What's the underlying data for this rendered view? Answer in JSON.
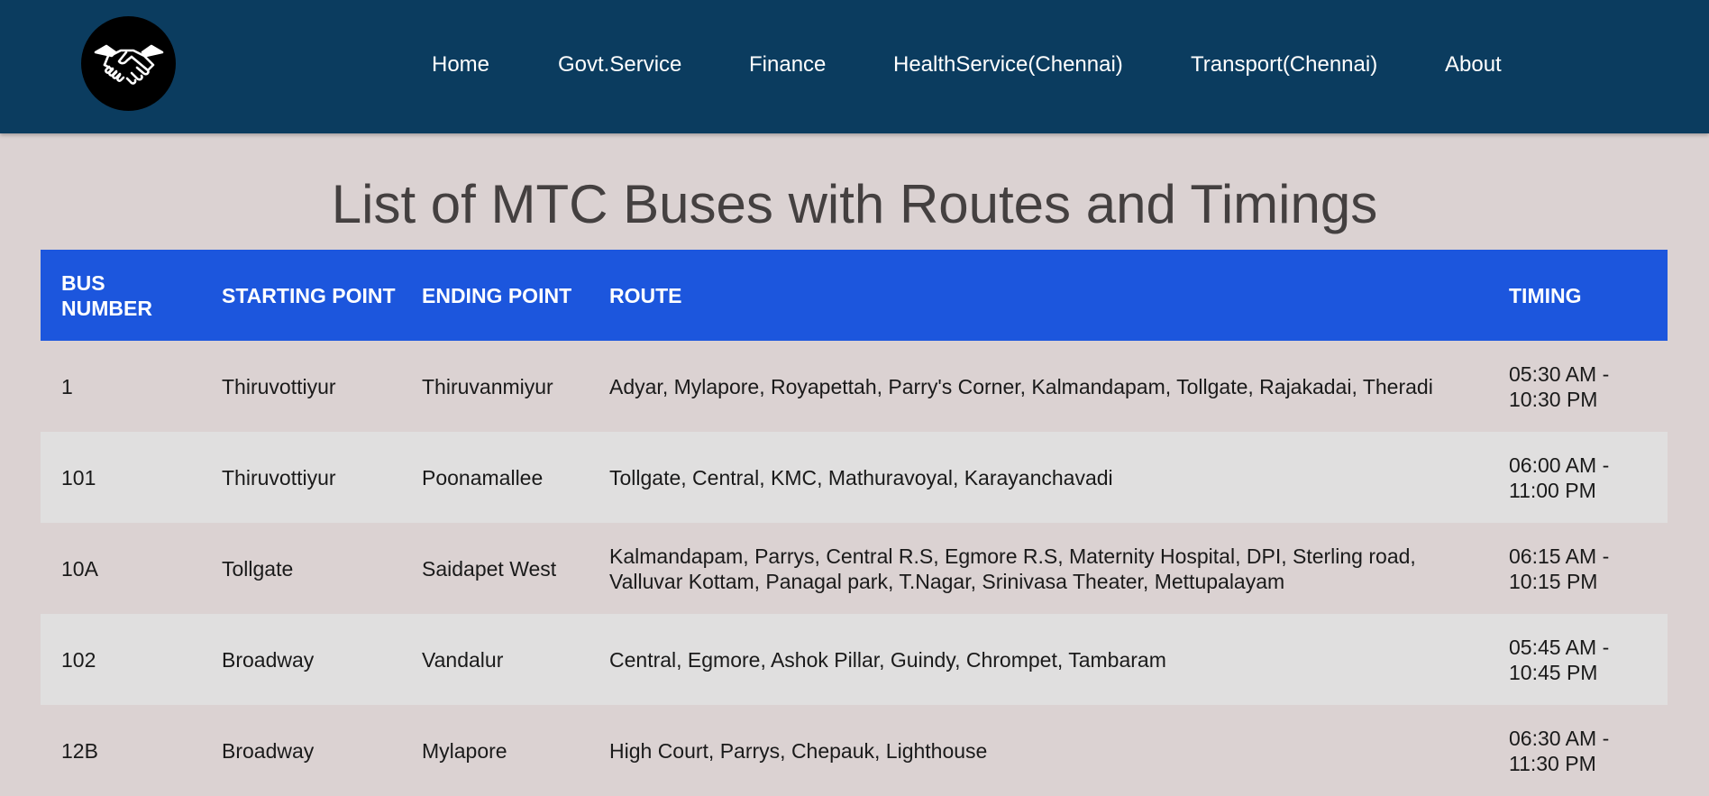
{
  "header": {
    "logo_icon": "handshake-icon",
    "nav": [
      {
        "label": "Home"
      },
      {
        "label": "Govt.Service"
      },
      {
        "label": "Finance"
      },
      {
        "label": "HealthService(Chennai)"
      },
      {
        "label": "Transport(Chennai)"
      },
      {
        "label": "About"
      }
    ]
  },
  "main": {
    "title": "List of MTC Buses with Routes and Timings",
    "table": {
      "columns": [
        "BUS NUMBER",
        "STARTING POINT",
        "ENDING POINT",
        "ROUTE",
        "TIMING"
      ],
      "rows": [
        {
          "bus": "1",
          "start": "Thiruvottiyur",
          "end": "Thiruvanmiyur",
          "route": "Adyar, Mylapore, Royapettah, Parry's Corner, Kalmandapam, Tollgate, Rajakadai, Theradi",
          "timing": "05:30 AM - 10:30 PM"
        },
        {
          "bus": "101",
          "start": "Thiruvottiyur",
          "end": "Poonamallee",
          "route": "Tollgate, Central, KMC, Mathuravoyal, Karayanchavadi",
          "timing": "06:00 AM - 11:00 PM"
        },
        {
          "bus": "10A",
          "start": "Tollgate",
          "end": "Saidapet West",
          "route": "Kalmandapam, Parrys, Central R.S, Egmore R.S, Maternity Hospital, DPI, Sterling road, Valluvar Kottam, Panagal park, T.Nagar, Srinivasa Theater, Mettupalayam",
          "timing": "06:15 AM - 10:15 PM"
        },
        {
          "bus": "102",
          "start": "Broadway",
          "end": "Vandalur",
          "route": "Central, Egmore, Ashok Pillar, Guindy, Chrompet, Tambaram",
          "timing": "05:45 AM - 10:45 PM"
        },
        {
          "bus": "12B",
          "start": "Broadway",
          "end": "Mylapore",
          "route": "High Court, Parrys, Chepauk, Lighthouse",
          "timing": "06:30 AM - 11:30 PM"
        }
      ]
    }
  },
  "colors": {
    "navbar_bg": "#0b3c5f",
    "page_bg": "#dbd2d2",
    "table_header_bg": "#1c56dd",
    "row_alt_bg": "#e0dfdf",
    "title_color": "#444040"
  }
}
